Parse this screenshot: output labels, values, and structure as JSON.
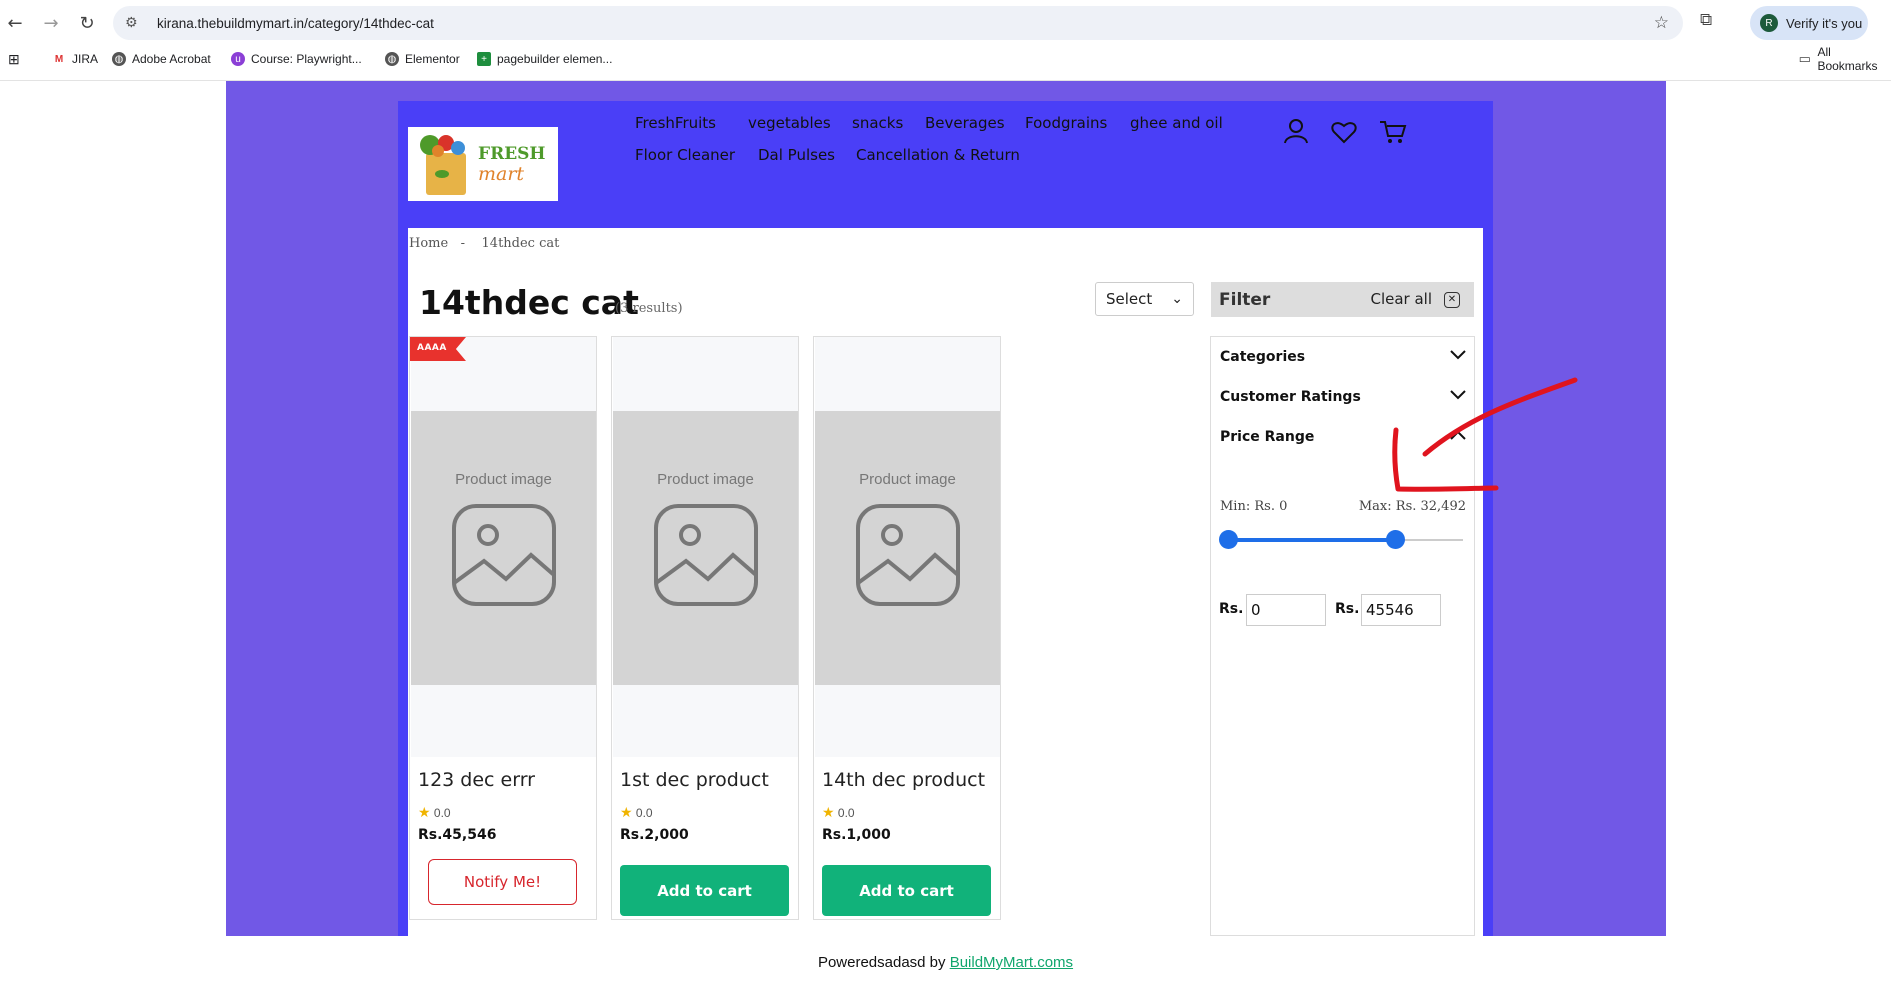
{
  "browser": {
    "url": "kirana.thebuildmymart.in/category/14thdec-cat",
    "profile_label": "Verify it's you",
    "profile_initial": "R",
    "bookmarks": [
      "JIRA",
      "Adobe Acrobat",
      "Course: Playwright...",
      "Elementor",
      "pagebuilder elemen..."
    ],
    "all_bookmarks_label": "All Bookmarks"
  },
  "header": {
    "logo_word1": "FRESH",
    "logo_word2": "mart",
    "menu": [
      "FreshFruits",
      "vegetables",
      "snacks",
      "Beverages",
      "Foodgrains",
      "ghee and oil",
      "Floor Cleaner",
      "Dal Pulses",
      "Cancellation & Return"
    ],
    "icons": [
      "user-icon",
      "heart-icon",
      "cart-icon"
    ]
  },
  "breadcrumb": {
    "home": "Home",
    "separator": "-",
    "current": "14thdec cat"
  },
  "category": {
    "title": "14thdec cat",
    "results": "(3 results)"
  },
  "sort": {
    "selected": "Select"
  },
  "products": [
    {
      "badge": "AAAA",
      "image_placeholder": "Product image",
      "name": "123 dec errr",
      "rating": "0.0",
      "price": "Rs.45,546",
      "action": "Notify Me!"
    },
    {
      "badge": "",
      "image_placeholder": "Product image",
      "name": "1st dec product",
      "rating": "0.0",
      "price": "Rs.2,000",
      "action": "Add to cart"
    },
    {
      "badge": "",
      "image_placeholder": "Product image",
      "name": "14th dec product",
      "rating": "0.0",
      "price": "Rs.1,000",
      "action": "Add to cart"
    }
  ],
  "filter": {
    "title": "Filter",
    "clear_all": "Clear all",
    "clear_icon": "✕",
    "facets": [
      "Categories",
      "Customer Ratings",
      "Price Range"
    ],
    "min_label": "Min: Rs. 0",
    "max_label": "Max: Rs. 32,492",
    "slider_min_fraction": 0.0,
    "slider_max_fraction": 0.7134,
    "currency": "Rs.",
    "min_value": "0",
    "max_value": "45546"
  },
  "footer": {
    "text": "Poweredsadasd by ",
    "link": "BuildMyMart.coms"
  },
  "colors": {
    "outer_bg": "#7158e6",
    "inner_bg": "#4a3ff7",
    "accent_green": "#11b27a",
    "slider_blue": "#1e6ee8",
    "notify_red": "#d7262d",
    "annotation_red": "#e0141e"
  }
}
